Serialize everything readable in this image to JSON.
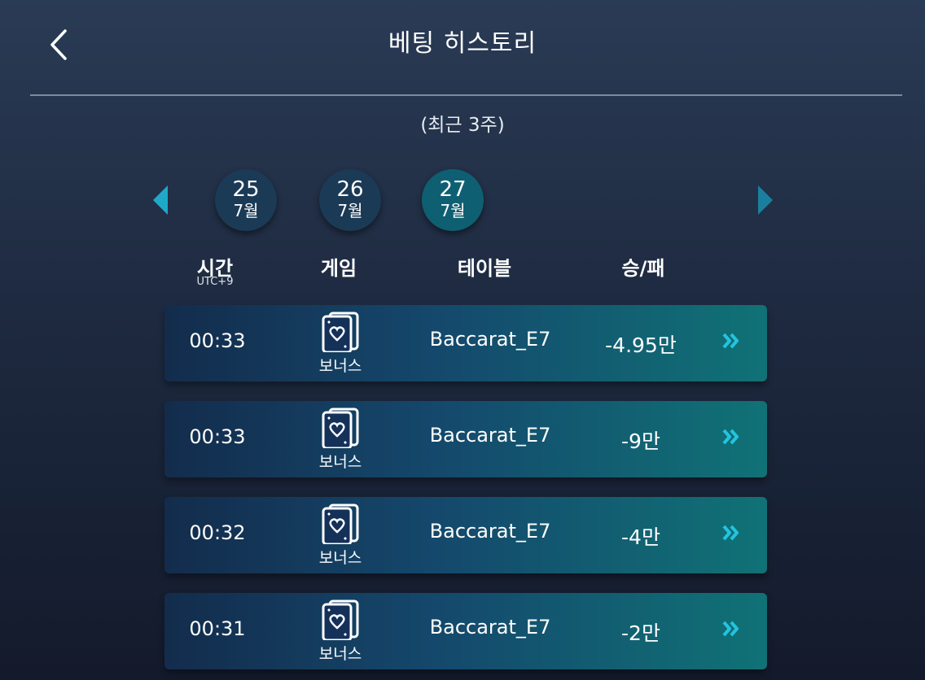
{
  "header": {
    "title": "베팅 히스토리",
    "back_icon": "chevron-left-icon"
  },
  "period_label": "(최근 3주)",
  "date_nav": {
    "prev_icon": "triangle-left-icon",
    "next_icon": "triangle-right-icon",
    "dates": [
      {
        "day": "25",
        "month": "7월",
        "selected": false
      },
      {
        "day": "26",
        "month": "7월",
        "selected": false
      },
      {
        "day": "27",
        "month": "7월",
        "selected": true
      }
    ]
  },
  "columns": {
    "time": "시간",
    "time_sub": "UTC+9",
    "game": "게임",
    "table": "테이블",
    "result": "승/패"
  },
  "rows": [
    {
      "time": "00:33",
      "game": "보너스",
      "game_icon": "card-heart-icon",
      "table": "Baccarat_E7",
      "result": "-4.95만"
    },
    {
      "time": "00:33",
      "game": "보너스",
      "game_icon": "card-heart-icon",
      "table": "Baccarat_E7",
      "result": "-9만"
    },
    {
      "time": "00:32",
      "game": "보너스",
      "game_icon": "card-heart-icon",
      "table": "Baccarat_E7",
      "result": "-4만"
    },
    {
      "time": "00:31",
      "game": "보너스",
      "game_icon": "card-heart-icon",
      "table": "Baccarat_E7",
      "result": "-2만"
    }
  ],
  "colors": {
    "accent": "#1fa9c8",
    "selected_date": "#0f5f72",
    "date_chip": "#1b3a55",
    "detail_arrow": "#23c3e0"
  }
}
